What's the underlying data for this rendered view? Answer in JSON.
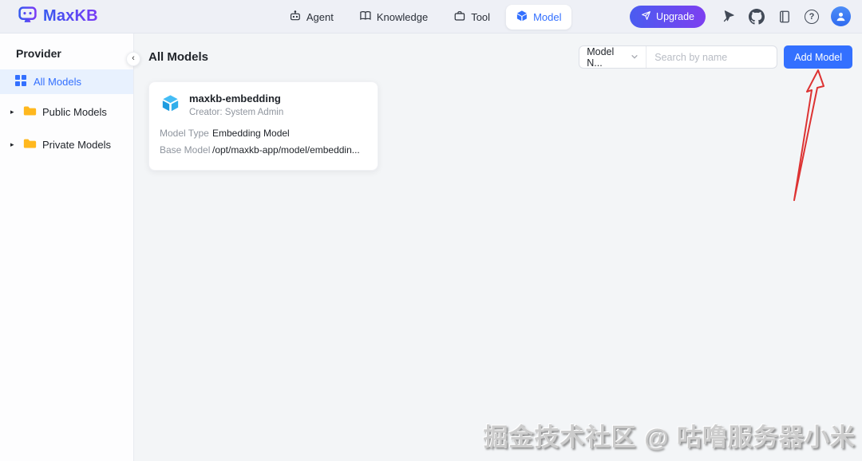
{
  "colors": {
    "brand": "#3370ff",
    "brand_gradient_start": "#3558f0",
    "brand_gradient_end": "#7a3bf5",
    "navbar_bg": "#eef0f6",
    "main_bg": "#f3f5f7",
    "active_item_bg": "#e8f1fe",
    "folder_yellow": "#ffb81e",
    "cube_blue": "#2fb0ec",
    "arrow_red": "#dd3333"
  },
  "navbar": {
    "logo_text": "MaxKB",
    "tabs": [
      {
        "label": "Agent",
        "active": false
      },
      {
        "label": "Knowledge",
        "active": false
      },
      {
        "label": "Tool",
        "active": false
      },
      {
        "label": "Model",
        "active": true
      }
    ],
    "upgrade_label": "Upgrade",
    "help_glyph": "?"
  },
  "sidebar": {
    "title": "Provider",
    "items": [
      {
        "label": "All Models",
        "active": true
      },
      {
        "label": "Public Models",
        "active": false
      },
      {
        "label": "Private Models",
        "active": false
      }
    ],
    "collapse_glyph": "‹",
    "caret_glyph": "▸"
  },
  "main": {
    "title": "All Models",
    "filter_value": "Model N...",
    "search_placeholder": "Search by name",
    "add_button": "Add Model",
    "card": {
      "name": "maxkb-embedding",
      "creator": "Creator: System Admin",
      "fields": [
        {
          "label": "Model Type",
          "value": "Embedding Model"
        },
        {
          "label": "Base Model",
          "value": "/opt/maxkb-app/model/embeddin..."
        }
      ]
    }
  },
  "watermark": "掘金技术社区 @ 咕噜服务器小米"
}
